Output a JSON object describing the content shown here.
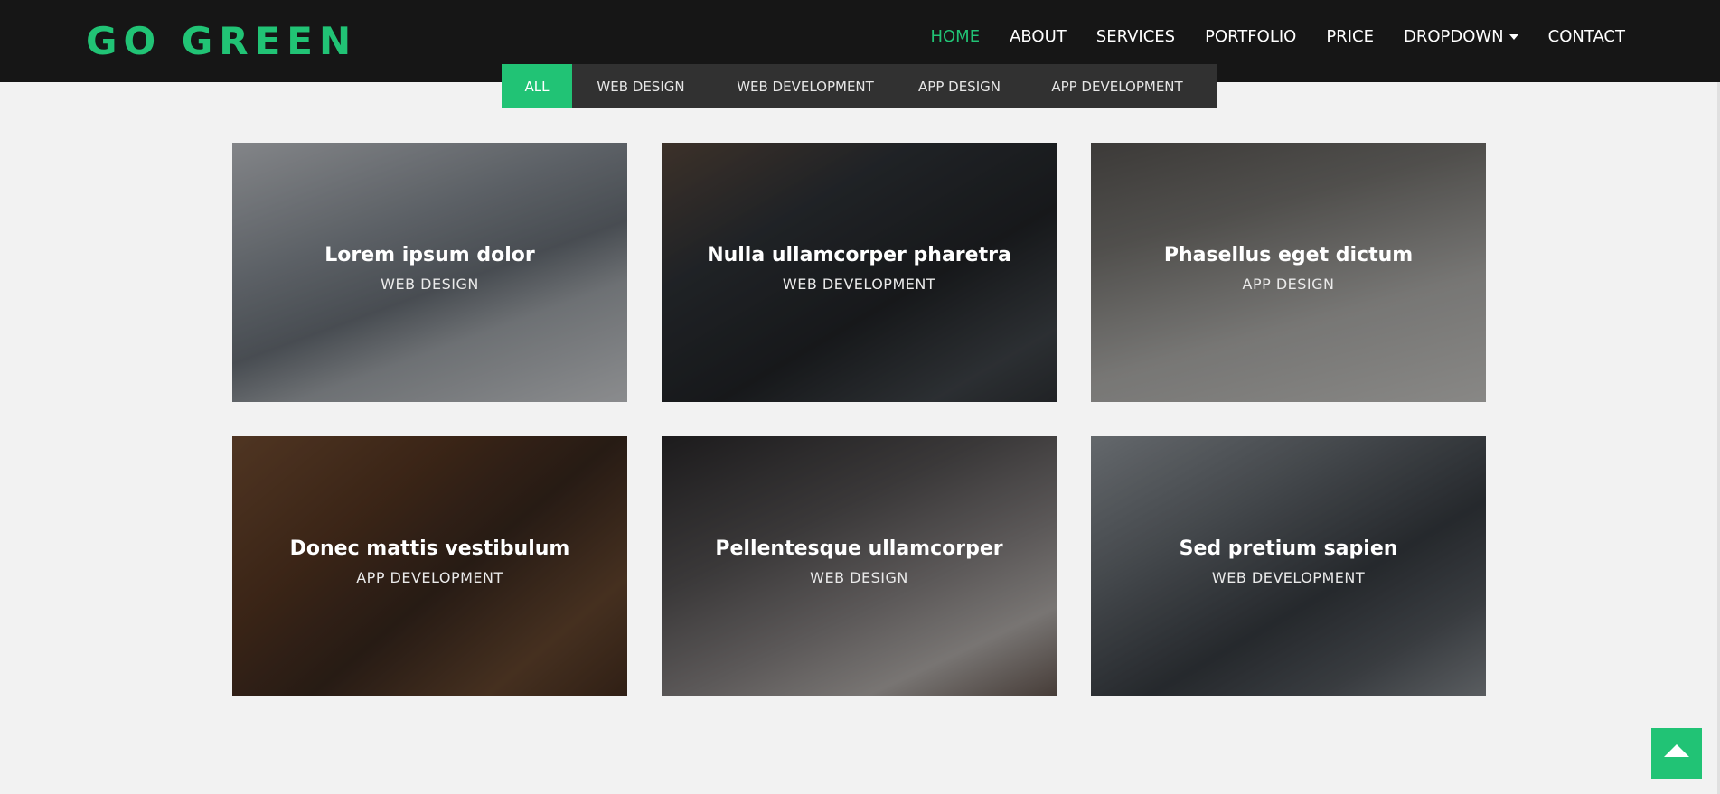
{
  "brand": "GO GREEN",
  "nav": {
    "items": [
      {
        "label": "HOME",
        "active": true
      },
      {
        "label": "ABOUT",
        "active": false
      },
      {
        "label": "SERVICES",
        "active": false
      },
      {
        "label": "PORTFOLIO",
        "active": false
      },
      {
        "label": "PRICE",
        "active": false
      },
      {
        "label": "DROPDOWN",
        "active": false,
        "has_caret": true
      },
      {
        "label": "CONTACT",
        "active": false
      }
    ]
  },
  "filters": [
    {
      "label": "ALL",
      "active": true
    },
    {
      "label": "WEB DESIGN",
      "active": false
    },
    {
      "label": "WEB DEVELOPMENT",
      "active": false
    },
    {
      "label": "APP DESIGN",
      "active": false
    },
    {
      "label": "APP DEVELOPMENT",
      "active": false
    }
  ],
  "portfolio": [
    {
      "title": "Lorem ipsum dolor",
      "category": "WEB DESIGN"
    },
    {
      "title": "Nulla ullamcorper pharetra",
      "category": "WEB DEVELOPMENT"
    },
    {
      "title": "Phasellus eget dictum",
      "category": "APP DESIGN"
    },
    {
      "title": "Donec mattis vestibulum",
      "category": "APP DEVELOPMENT"
    },
    {
      "title": "Pellentesque ullamcorper",
      "category": "WEB DESIGN"
    },
    {
      "title": "Sed pretium sapien",
      "category": "WEB DEVELOPMENT"
    }
  ],
  "icons": {
    "scroll_top": "arrow-up-icon",
    "dropdown": "caret-down-icon"
  },
  "colors": {
    "accent": "#21c375",
    "navbar": "#161616",
    "filter_bar": "#313131",
    "background": "#f2f2f2"
  }
}
